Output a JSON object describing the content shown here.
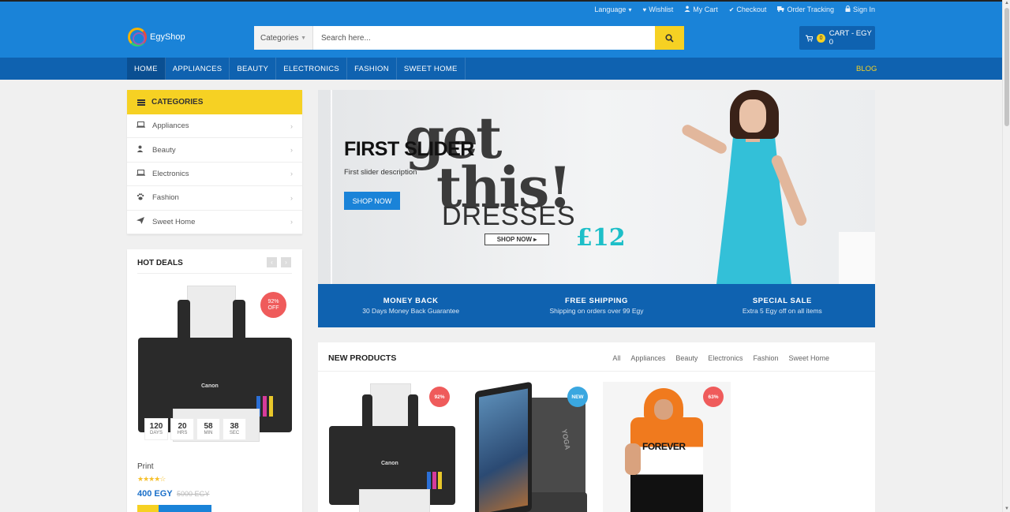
{
  "top_links": [
    {
      "icon": "language",
      "label": "Language",
      "suffix": "▾"
    },
    {
      "icon": "heart-icon",
      "label": "Wishlist"
    },
    {
      "icon": "user-icon",
      "label": "My Cart"
    },
    {
      "icon": "check-icon",
      "label": "Checkout"
    },
    {
      "icon": "truck-icon",
      "label": "Order Tracking"
    },
    {
      "icon": "lock-icon",
      "label": "Sign In"
    }
  ],
  "brand": {
    "name": "EgyShop"
  },
  "search": {
    "category": "Categories",
    "placeholder": "Search here..."
  },
  "cart": {
    "count": "0",
    "label": "CART - EGY 0"
  },
  "nav": {
    "items": [
      "HOME",
      "APPLIANCES",
      "BEAUTY",
      "ELECTRONICS",
      "FASHION",
      "SWEET HOME"
    ],
    "active": "HOME",
    "blog": "BLOG"
  },
  "categories": {
    "title": "CATEGORIES",
    "items": [
      {
        "label": "Appliances",
        "icon": "laptop-icon"
      },
      {
        "label": "Beauty",
        "icon": "user-icon"
      },
      {
        "label": "Electronics",
        "icon": "laptop-icon"
      },
      {
        "label": "Fashion",
        "icon": "paw-icon"
      },
      {
        "label": "Sweet Home",
        "icon": "send-icon"
      }
    ]
  },
  "hot_deals": {
    "title": "HOT DEALS",
    "badge_pct": "92%",
    "badge_off": "OFF",
    "countdown": [
      {
        "value": "120",
        "unit": "DAYS"
      },
      {
        "value": "20",
        "unit": "HRS"
      },
      {
        "value": "58",
        "unit": "MIN"
      },
      {
        "value": "38",
        "unit": "SEC"
      }
    ],
    "product_name": "Print",
    "rating_stars": 4,
    "rating_text": "★★★★☆",
    "price": "400 EGY",
    "old_price": "5000 EGY",
    "printer_brand": "Canon"
  },
  "slider": {
    "title": "FIRST SLIDER",
    "description": "First slider description",
    "button": "SHOP NOW",
    "art": {
      "word1": "get",
      "word2": "this!",
      "word3": "DRESSES",
      "price": "£12",
      "shop_now": "SHOP NOW ▸"
    }
  },
  "features": [
    {
      "title": "MONEY BACK",
      "subtitle": "30 Days Money Back Guarantee"
    },
    {
      "title": "FREE SHIPPING",
      "subtitle": "Shipping on orders over 99 Egy"
    },
    {
      "title": "SPECIAL SALE",
      "subtitle": "Extra 5 Egy off on all items"
    }
  ],
  "new_products": {
    "title": "NEW PRODUCTS",
    "tabs": [
      "All",
      "Appliances",
      "Beauty",
      "Electronics",
      "Fashion",
      "Sweet Home"
    ],
    "products": [
      {
        "badge": "92%",
        "badge_color": "#ef5b5b",
        "brand": "Canon"
      },
      {
        "badge": "NEW",
        "badge_color": "#3aa7e0",
        "brand": "YOGA"
      },
      {
        "badge": "63%",
        "badge_color": "#ef5b5b",
        "print": "FOREVER"
      }
    ]
  },
  "colors": {
    "primary": "#1a83d8",
    "nav": "#0f62b0",
    "accent": "#f6d123",
    "sale": "#ef5b5b"
  }
}
